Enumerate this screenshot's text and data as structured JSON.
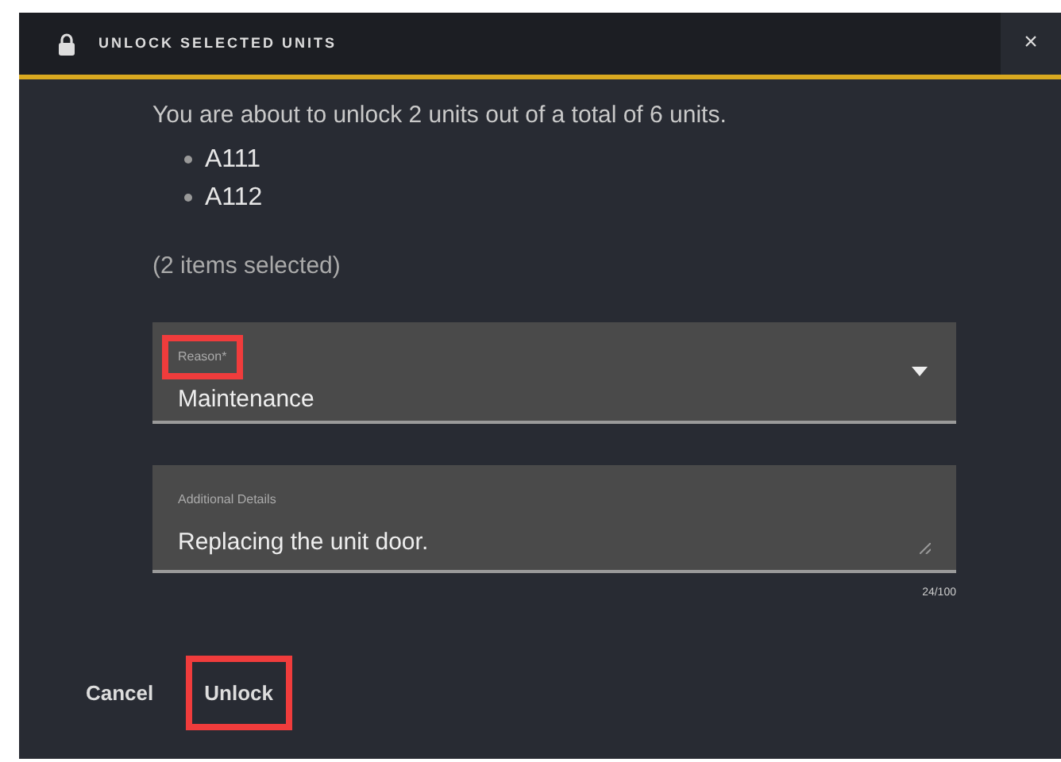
{
  "dialog": {
    "title": "UNLOCK SELECTED UNITS",
    "close": "×"
  },
  "message": "You are about to unlock 2 units out of a total of 6 units.",
  "units": [
    "A111",
    "A112"
  ],
  "selection_count": "(2 items selected)",
  "reason_field": {
    "label": "Reason*",
    "value": "Maintenance",
    "highlighted": true
  },
  "details_field": {
    "label": "Additional Details",
    "value": "Replacing the unit door.",
    "counter": "24/100"
  },
  "buttons": [
    {
      "label": "Cancel",
      "highlighted": false
    },
    {
      "label": "Unlock",
      "highlighted": true
    }
  ]
}
